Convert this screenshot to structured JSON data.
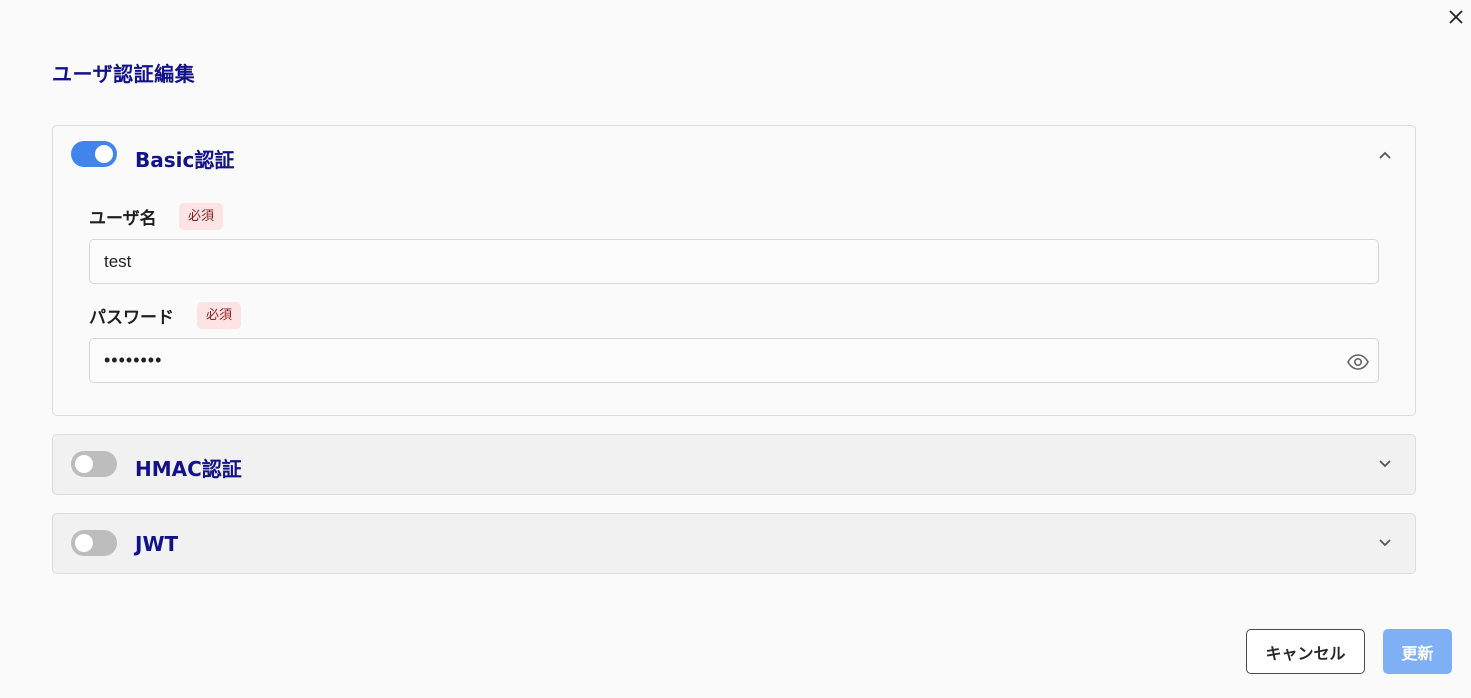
{
  "dialog": {
    "title": "ユーザ認証編集",
    "close_icon": "close-icon"
  },
  "sections": [
    {
      "name": "Basic認証",
      "enabled": true,
      "expanded": true,
      "fields": {
        "username": {
          "label": "ユーザ名",
          "required_label": "必須",
          "value": "test"
        },
        "password": {
          "label": "パスワード",
          "required_label": "必須",
          "value": "••••••••",
          "reveal_icon": "eye-icon"
        }
      }
    },
    {
      "name": "HMAC認証",
      "enabled": false,
      "expanded": false
    },
    {
      "name": "JWT",
      "enabled": false,
      "expanded": false
    }
  ],
  "footer": {
    "cancel_label": "キャンセル",
    "update_label": "更新"
  },
  "colors": {
    "accent": "#4284ee",
    "title": "#14128a",
    "badge_bg": "#fde3e3",
    "badge_text": "#8a1f1f",
    "update_button": "#7fb0f6"
  }
}
